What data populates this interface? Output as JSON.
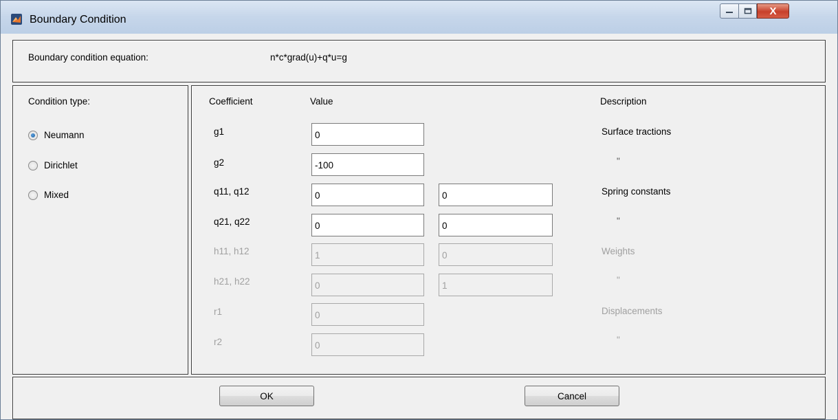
{
  "window": {
    "title": "Boundary Condition",
    "close_glyph": "X"
  },
  "equation": {
    "label": "Boundary condition equation:",
    "value": "n*c*grad(u)+q*u=g"
  },
  "condition": {
    "label": "Condition type:",
    "options": [
      {
        "label": "Neumann",
        "checked": true
      },
      {
        "label": "Dirichlet",
        "checked": false
      },
      {
        "label": "Mixed",
        "checked": false
      }
    ]
  },
  "table": {
    "headers": {
      "coefficient": "Coefficient",
      "value": "Value",
      "description": "Description"
    },
    "rows": [
      {
        "coef": "g1",
        "v1": "0",
        "v2": "",
        "desc": "Surface tractions",
        "enabled": true
      },
      {
        "coef": "g2",
        "v1": "-100",
        "v2": "",
        "desc": "\"",
        "enabled": true
      },
      {
        "coef": "q11, q12",
        "v1": "0",
        "v2": "0",
        "desc": "Spring constants",
        "enabled": true
      },
      {
        "coef": "q21, q22",
        "v1": "0",
        "v2": "0",
        "desc": "\"",
        "enabled": true
      },
      {
        "coef": "h11, h12",
        "v1": "1",
        "v2": "0",
        "desc": "Weights",
        "enabled": false
      },
      {
        "coef": "h21, h22",
        "v1": "0",
        "v2": "1",
        "desc": "\"",
        "enabled": false
      },
      {
        "coef": "r1",
        "v1": "0",
        "v2": "",
        "desc": "Displacements",
        "enabled": false
      },
      {
        "coef": "r2",
        "v1": "0",
        "v2": "",
        "desc": "\"",
        "enabled": false
      }
    ]
  },
  "buttons": {
    "ok": "OK",
    "cancel": "Cancel"
  }
}
